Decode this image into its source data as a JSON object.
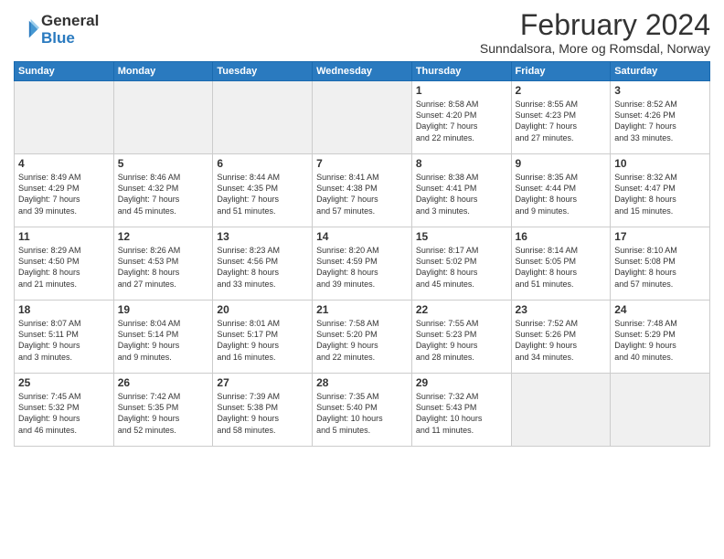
{
  "logo": {
    "general": "General",
    "blue": "Blue"
  },
  "title": "February 2024",
  "location": "Sunndalsora, More og Romsdal, Norway",
  "headers": [
    "Sunday",
    "Monday",
    "Tuesday",
    "Wednesday",
    "Thursday",
    "Friday",
    "Saturday"
  ],
  "weeks": [
    [
      {
        "day": "",
        "info": "",
        "empty": true
      },
      {
        "day": "",
        "info": "",
        "empty": true
      },
      {
        "day": "",
        "info": "",
        "empty": true
      },
      {
        "day": "",
        "info": "",
        "empty": true
      },
      {
        "day": "1",
        "info": "Sunrise: 8:58 AM\nSunset: 4:20 PM\nDaylight: 7 hours\nand 22 minutes.",
        "empty": false
      },
      {
        "day": "2",
        "info": "Sunrise: 8:55 AM\nSunset: 4:23 PM\nDaylight: 7 hours\nand 27 minutes.",
        "empty": false
      },
      {
        "day": "3",
        "info": "Sunrise: 8:52 AM\nSunset: 4:26 PM\nDaylight: 7 hours\nand 33 minutes.",
        "empty": false
      }
    ],
    [
      {
        "day": "4",
        "info": "Sunrise: 8:49 AM\nSunset: 4:29 PM\nDaylight: 7 hours\nand 39 minutes.",
        "empty": false
      },
      {
        "day": "5",
        "info": "Sunrise: 8:46 AM\nSunset: 4:32 PM\nDaylight: 7 hours\nand 45 minutes.",
        "empty": false
      },
      {
        "day": "6",
        "info": "Sunrise: 8:44 AM\nSunset: 4:35 PM\nDaylight: 7 hours\nand 51 minutes.",
        "empty": false
      },
      {
        "day": "7",
        "info": "Sunrise: 8:41 AM\nSunset: 4:38 PM\nDaylight: 7 hours\nand 57 minutes.",
        "empty": false
      },
      {
        "day": "8",
        "info": "Sunrise: 8:38 AM\nSunset: 4:41 PM\nDaylight: 8 hours\nand 3 minutes.",
        "empty": false
      },
      {
        "day": "9",
        "info": "Sunrise: 8:35 AM\nSunset: 4:44 PM\nDaylight: 8 hours\nand 9 minutes.",
        "empty": false
      },
      {
        "day": "10",
        "info": "Sunrise: 8:32 AM\nSunset: 4:47 PM\nDaylight: 8 hours\nand 15 minutes.",
        "empty": false
      }
    ],
    [
      {
        "day": "11",
        "info": "Sunrise: 8:29 AM\nSunset: 4:50 PM\nDaylight: 8 hours\nand 21 minutes.",
        "empty": false
      },
      {
        "day": "12",
        "info": "Sunrise: 8:26 AM\nSunset: 4:53 PM\nDaylight: 8 hours\nand 27 minutes.",
        "empty": false
      },
      {
        "day": "13",
        "info": "Sunrise: 8:23 AM\nSunset: 4:56 PM\nDaylight: 8 hours\nand 33 minutes.",
        "empty": false
      },
      {
        "day": "14",
        "info": "Sunrise: 8:20 AM\nSunset: 4:59 PM\nDaylight: 8 hours\nand 39 minutes.",
        "empty": false
      },
      {
        "day": "15",
        "info": "Sunrise: 8:17 AM\nSunset: 5:02 PM\nDaylight: 8 hours\nand 45 minutes.",
        "empty": false
      },
      {
        "day": "16",
        "info": "Sunrise: 8:14 AM\nSunset: 5:05 PM\nDaylight: 8 hours\nand 51 minutes.",
        "empty": false
      },
      {
        "day": "17",
        "info": "Sunrise: 8:10 AM\nSunset: 5:08 PM\nDaylight: 8 hours\nand 57 minutes.",
        "empty": false
      }
    ],
    [
      {
        "day": "18",
        "info": "Sunrise: 8:07 AM\nSunset: 5:11 PM\nDaylight: 9 hours\nand 3 minutes.",
        "empty": false
      },
      {
        "day": "19",
        "info": "Sunrise: 8:04 AM\nSunset: 5:14 PM\nDaylight: 9 hours\nand 9 minutes.",
        "empty": false
      },
      {
        "day": "20",
        "info": "Sunrise: 8:01 AM\nSunset: 5:17 PM\nDaylight: 9 hours\nand 16 minutes.",
        "empty": false
      },
      {
        "day": "21",
        "info": "Sunrise: 7:58 AM\nSunset: 5:20 PM\nDaylight: 9 hours\nand 22 minutes.",
        "empty": false
      },
      {
        "day": "22",
        "info": "Sunrise: 7:55 AM\nSunset: 5:23 PM\nDaylight: 9 hours\nand 28 minutes.",
        "empty": false
      },
      {
        "day": "23",
        "info": "Sunrise: 7:52 AM\nSunset: 5:26 PM\nDaylight: 9 hours\nand 34 minutes.",
        "empty": false
      },
      {
        "day": "24",
        "info": "Sunrise: 7:48 AM\nSunset: 5:29 PM\nDaylight: 9 hours\nand 40 minutes.",
        "empty": false
      }
    ],
    [
      {
        "day": "25",
        "info": "Sunrise: 7:45 AM\nSunset: 5:32 PM\nDaylight: 9 hours\nand 46 minutes.",
        "empty": false
      },
      {
        "day": "26",
        "info": "Sunrise: 7:42 AM\nSunset: 5:35 PM\nDaylight: 9 hours\nand 52 minutes.",
        "empty": false
      },
      {
        "day": "27",
        "info": "Sunrise: 7:39 AM\nSunset: 5:38 PM\nDaylight: 9 hours\nand 58 minutes.",
        "empty": false
      },
      {
        "day": "28",
        "info": "Sunrise: 7:35 AM\nSunset: 5:40 PM\nDaylight: 10 hours\nand 5 minutes.",
        "empty": false
      },
      {
        "day": "29",
        "info": "Sunrise: 7:32 AM\nSunset: 5:43 PM\nDaylight: 10 hours\nand 11 minutes.",
        "empty": false
      },
      {
        "day": "",
        "info": "",
        "empty": true
      },
      {
        "day": "",
        "info": "",
        "empty": true
      }
    ]
  ]
}
